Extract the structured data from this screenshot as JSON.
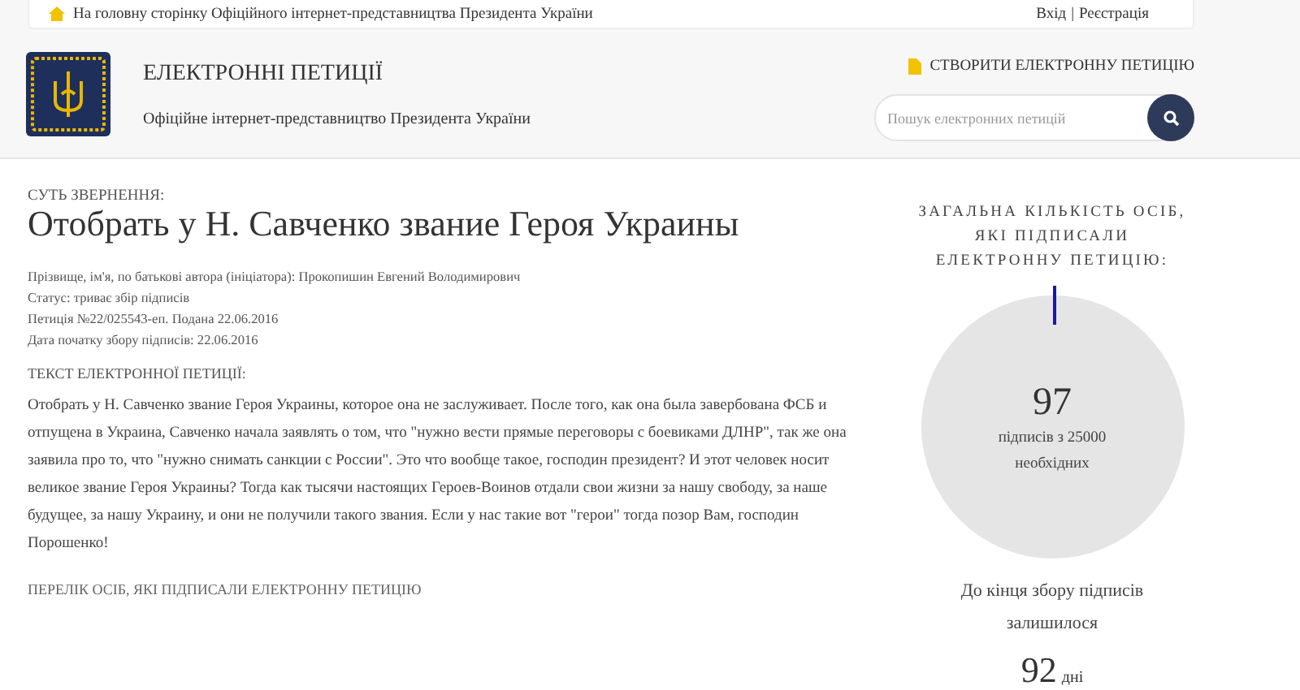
{
  "top_bar": {
    "home_link": "На головну сторінку Офіційного інтернет-представництва Президента України",
    "login": "Вхід",
    "separator": "|",
    "register": "Реєстрація"
  },
  "header": {
    "title": "ЕЛЕКТРОННІ ПЕТИЦІЇ",
    "subtitle": "Офіційне інтернет-представництво Президента України",
    "create_link": "СТВОРИТИ ЕЛЕКТРОННУ ПЕТИЦІЮ",
    "search": {
      "placeholder": "Пошук електронних петицій"
    }
  },
  "petition": {
    "essence_label": "СУТЬ ЗВЕРНЕННЯ:",
    "title": "Отобрать у Н. Савченко звание Героя Украины",
    "meta": [
      "Прізвище, ім'я, по батькові автора (ініціатора): Прокопишин Евгений Володимирович",
      "Статус: триває збір підписів",
      "Петиція №22/025543-еп. Подана 22.06.2016",
      "Дата початку збору підписів: 22.06.2016"
    ],
    "text_label": "ТЕКСТ ЕЛЕКТРОННОЇ ПЕТИЦІЇ:",
    "text": "Отобрать у Н. Савченко звание Героя Украины, которое она не заслуживает. После того, как она была завербована ФСБ и отпущена в Украина, Савченко начала заявлять о том, что \"нужно вести прямые переговоры с боевиками ДЛНР\", так же она заявила про то, что \"нужно снимать санкции с России\". Это что вообще такое, господин президент? И этот человек носит великое звание Героя Украины? Тогда как тысячи настоящих Героев-Воинов отдали свои жизни за нашу свободу, за наше будущее, за нашу Украину, и они не получили такого звания. Если у нас такие вот \"герои\" тогда позор Вам, господин Порошенко!",
    "signers_link": "ПЕРЕЛІК ОСІБ, ЯКІ ПІДПИСАЛИ ЕЛЕКТРОННУ ПЕТИЦІЮ"
  },
  "stats": {
    "heading": "ЗАГАЛЬНА КІЛЬКІСТЬ ОСІБ, ЯКІ ПІДПИСАЛИ ЕЛЕКТРОННУ ПЕТИЦІЮ:",
    "count": "97",
    "count_caption": "підписів з 25000 необхідних",
    "remaining_label": "До кінця збору підписів залишилося",
    "days": "92",
    "days_unit": "дні"
  }
}
